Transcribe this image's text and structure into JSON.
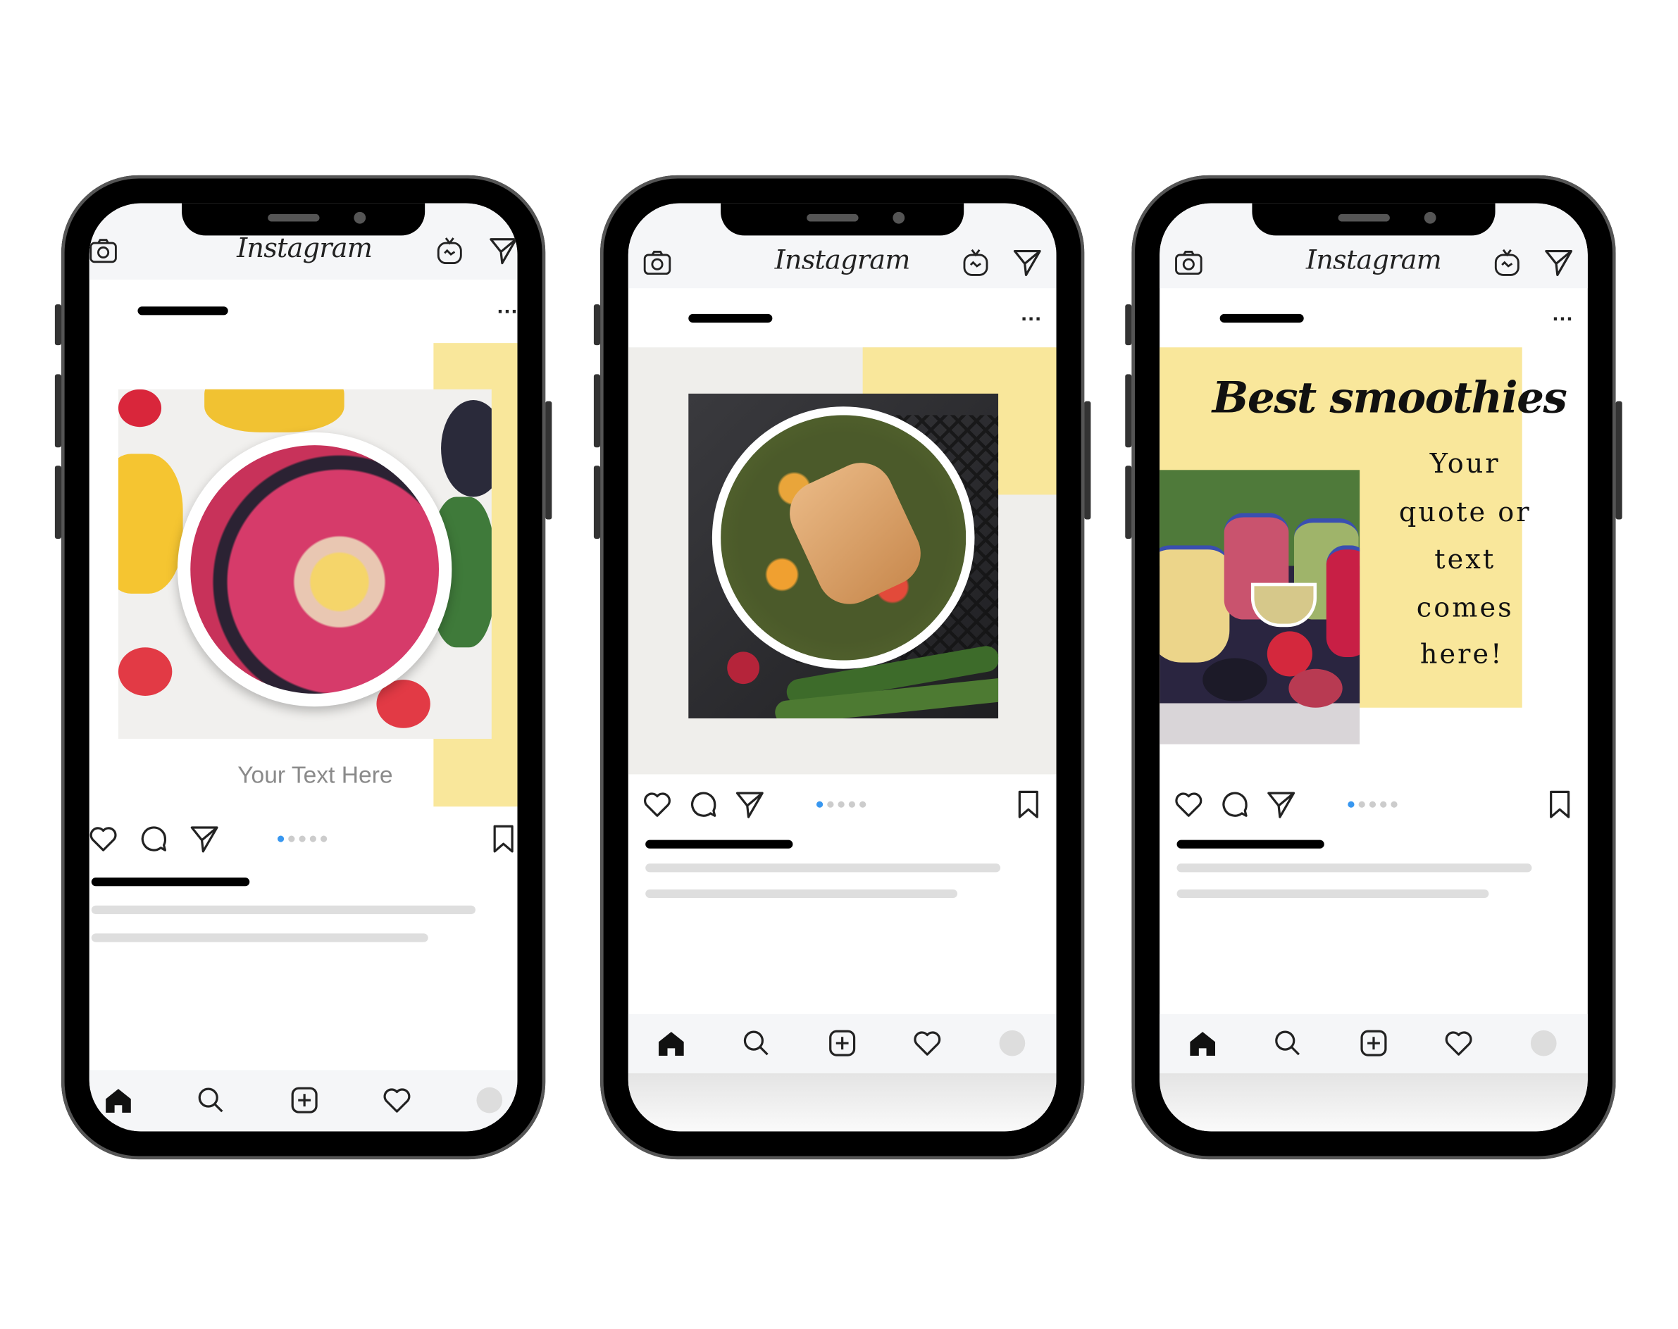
{
  "app": {
    "title": "Instagram"
  },
  "colors": {
    "accent_yellow": "#f9e79b",
    "active_dot": "#3897f0",
    "header_bg": "#f5f6f8",
    "placeholder_line": "#dedede"
  },
  "icons": {
    "camera": "camera-icon",
    "igtv": "igtv-icon",
    "direct": "paper-plane-icon",
    "like": "heart-icon",
    "comment": "comment-icon",
    "share": "paper-plane-icon",
    "save": "bookmark-icon",
    "home": "home-icon",
    "search": "search-icon",
    "add": "plus-square-icon",
    "activity": "heart-icon",
    "profile": "avatar"
  },
  "phones": [
    {
      "post": {
        "caption_overlay": "Your Text Here",
        "more": "...",
        "carousel": {
          "count": 5,
          "active": 1
        }
      }
    },
    {
      "post": {
        "more": "...",
        "carousel": {
          "count": 5,
          "active": 1
        }
      }
    },
    {
      "post": {
        "headline": "Best smoothies",
        "quote_lines": [
          "Your",
          "quote or",
          "text",
          "comes",
          "here!"
        ],
        "more": "...",
        "carousel": {
          "count": 5,
          "active": 1
        }
      }
    }
  ]
}
